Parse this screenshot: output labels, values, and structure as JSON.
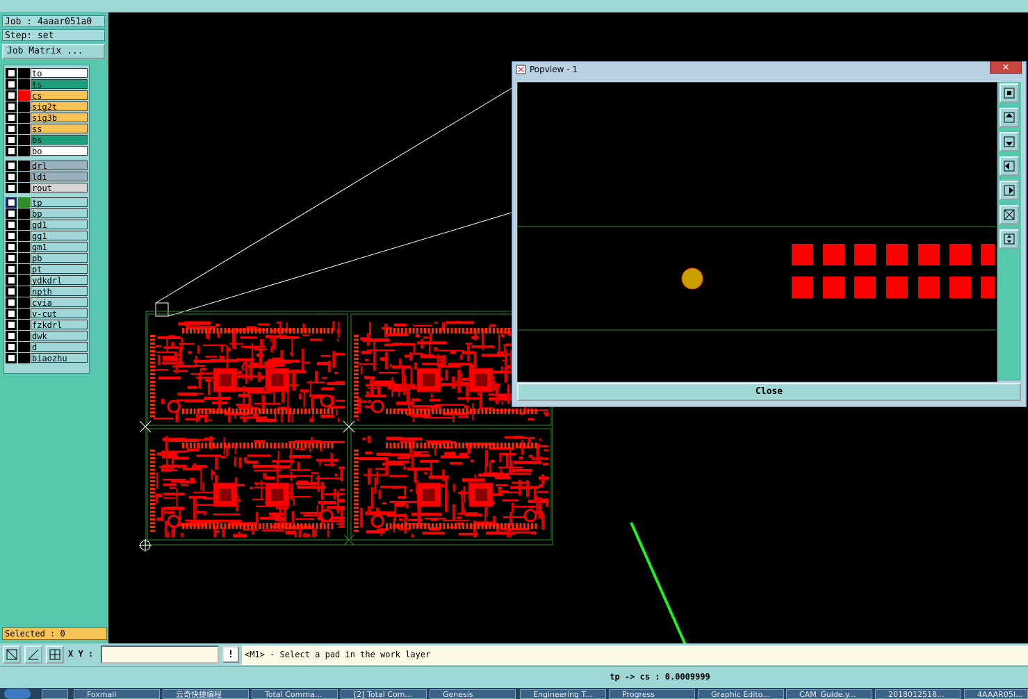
{
  "job_label": "Job : 4aaar051a0",
  "step_label": "Step: set",
  "job_matrix_button": "Job Matrix ...",
  "layers_group1": [
    {
      "name": "to",
      "color": "#ffffff",
      "flag": "#000000"
    },
    {
      "name": "ts",
      "color": "#1a9f7a",
      "flag": "#000000"
    },
    {
      "name": "cs",
      "color": "#f7c354",
      "flag": "#ff0000"
    },
    {
      "name": "sig2t",
      "color": "#f7c354",
      "flag": "#000000"
    },
    {
      "name": "sig3b",
      "color": "#f7c354",
      "flag": "#000000"
    },
    {
      "name": "ss",
      "color": "#f7c354",
      "flag": "#000000"
    },
    {
      "name": "bs",
      "color": "#1a9f7a",
      "flag": "#000000"
    },
    {
      "name": "bo",
      "color": "#ffffff",
      "flag": "#000000"
    }
  ],
  "layers_group2": [
    {
      "name": "drl",
      "color": "#9bb0bd",
      "flag": "#000000"
    },
    {
      "name": "ldi",
      "color": "#9bb0bd",
      "flag": "#000000"
    },
    {
      "name": "rout",
      "color": "#d6d6d6",
      "flag": "#000000"
    }
  ],
  "layers_group3": [
    {
      "name": "tp",
      "color": "#9fd6d6",
      "flag": "#2e8b2e"
    },
    {
      "name": "bp",
      "color": "#9fd6d6",
      "flag": "#000000"
    },
    {
      "name": "gd1",
      "color": "#9fd6d6",
      "flag": "#000000"
    },
    {
      "name": "gg1",
      "color": "#9fd6d6",
      "flag": "#000000"
    },
    {
      "name": "gm1",
      "color": "#9fd6d6",
      "flag": "#000000"
    },
    {
      "name": "pb",
      "color": "#9fd6d6",
      "flag": "#000000"
    },
    {
      "name": "pt",
      "color": "#9fd6d6",
      "flag": "#000000"
    },
    {
      "name": "ydkdrl",
      "color": "#9fd6d6",
      "flag": "#000000"
    },
    {
      "name": "npth",
      "color": "#9fd6d6",
      "flag": "#000000"
    },
    {
      "name": "cvia",
      "color": "#9fd6d6",
      "flag": "#000000"
    },
    {
      "name": "v-cut",
      "color": "#9fd6d6",
      "flag": "#000000"
    },
    {
      "name": "fzkdrl",
      "color": "#9fd6d6",
      "flag": "#000000"
    },
    {
      "name": "dwk",
      "color": "#9fd6d6",
      "flag": "#000000"
    },
    {
      "name": "d",
      "color": "#9fd6d6",
      "flag": "#000000"
    },
    {
      "name": "biaozhu",
      "color": "#9fd6d6",
      "flag": "#000000"
    }
  ],
  "selected_label": "Selected : 0",
  "xy_label": "X Y :",
  "xy_input_value": "",
  "bang_label": "!",
  "prompt_text": "<M1> - Select a pad in the work layer",
  "status_text": "tp -> cs : 0.0009999",
  "popview": {
    "title": "Popview - 1",
    "close_x": "✕",
    "close_button": "Close"
  },
  "taskbar_items": [
    "Foxmail",
    "云奇快捷编程",
    "Total Comma...",
    "[2] Total Com...",
    "Genesis",
    "Engineering T...",
    "Progress",
    "Graphic Edito...",
    "CAM_Guide.y...",
    "2018012518...",
    "4AAAR05I..."
  ],
  "colors": {
    "panel": "#57c8ad",
    "bar": "#9fd6d6",
    "pcb_copper": "#ff0000",
    "pad_highlight": "#c8a000",
    "arrow": "#22ee22"
  }
}
